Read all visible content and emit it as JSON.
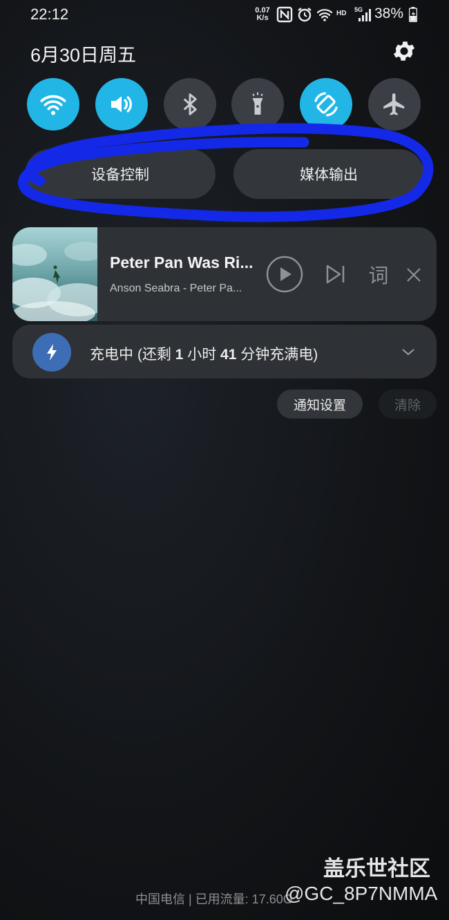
{
  "status_bar": {
    "time": "22:12",
    "net_speed_value": "0.07",
    "net_speed_unit": "K/s",
    "hd_label": "HD",
    "network_label": "5G",
    "battery_percent": "38%",
    "icons": [
      "nfc-icon",
      "alarm-icon",
      "wifi-icon",
      "signal-icon",
      "battery-charging-icon"
    ]
  },
  "header": {
    "date": "6月30日周五"
  },
  "quick_toggles": [
    {
      "name": "wifi-icon",
      "state": "on"
    },
    {
      "name": "sound-icon",
      "state": "on"
    },
    {
      "name": "bluetooth-icon",
      "state": "off"
    },
    {
      "name": "flashlight-icon",
      "state": "off"
    },
    {
      "name": "auto-rotate-icon",
      "state": "on"
    },
    {
      "name": "airplane-icon",
      "state": "off"
    }
  ],
  "panel_buttons": {
    "device_control": "设备控制",
    "media_output": "媒体输出"
  },
  "media": {
    "title": "Peter Pan Was Ri...",
    "subtitle": "Anson Seabra - Peter Pa...",
    "lyrics_label": "词"
  },
  "charging": {
    "text_prefix": "充电中 (还剩 ",
    "hours": "1",
    "hours_unit": " 小时 ",
    "minutes": "41",
    "minutes_suffix": " 分钟充满电)"
  },
  "actions": {
    "notification_settings": "通知设置",
    "clear": "清除"
  },
  "footer": {
    "carrier_text": "中国电信 | 已用流量: 17.60",
    "carrier_cut": "G"
  },
  "watermark": {
    "line1": "盖乐世社区",
    "line2": "@GC_8P7NMMA"
  },
  "colors": {
    "toggle_on": "#21b6e6",
    "toggle_off": "#3b3f45",
    "charging_accent": "#3d6db4",
    "annotation_scribble": "#1428e8"
  }
}
